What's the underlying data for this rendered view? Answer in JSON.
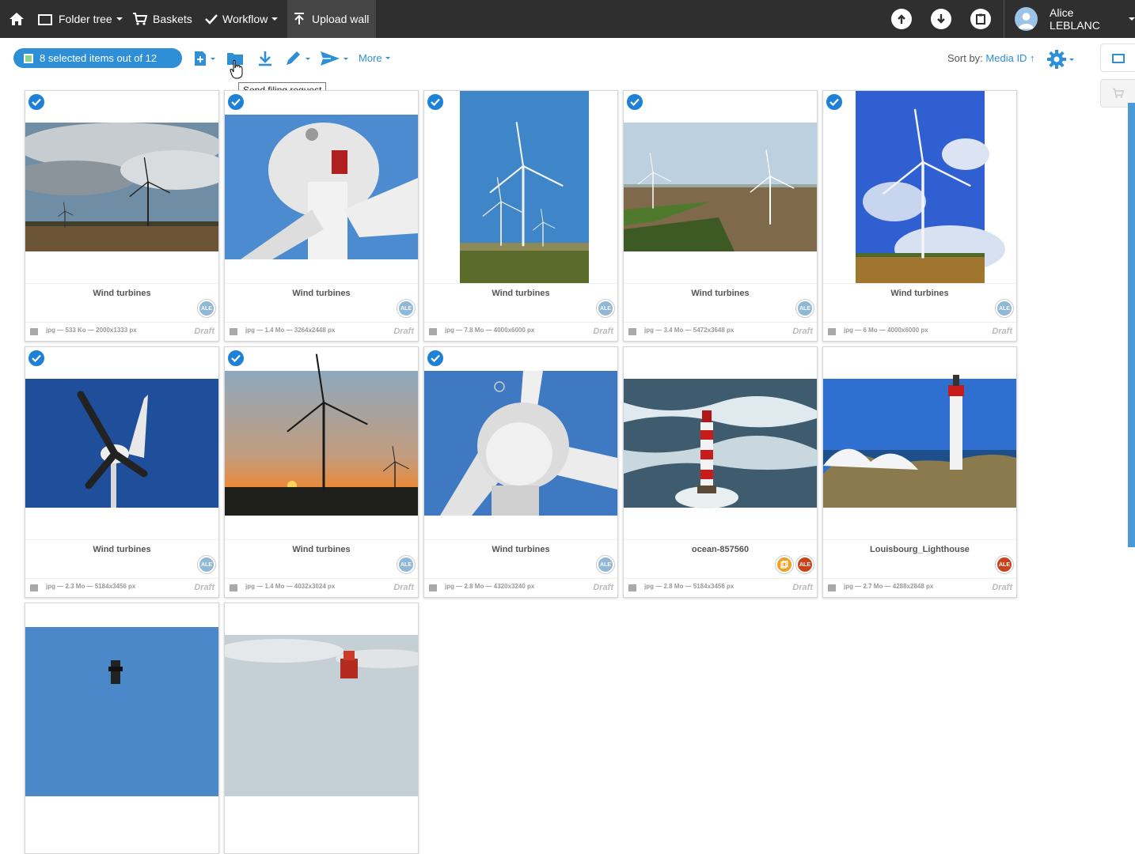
{
  "nav": {
    "folder_tree": "Folder tree",
    "baskets": "Baskets",
    "workflow": "Workflow",
    "upload_wall": "Upload wall",
    "user_name": "Alice LEBLANC"
  },
  "toolbar": {
    "selection_label": "8 selected items out of 12",
    "more_label": "More",
    "tooltip": "Send filing request",
    "sort_label": "Sort by:",
    "sort_value": "Media ID ↑"
  },
  "cards": [
    {
      "title": "Wind turbines",
      "info": "jpg — 533 Ko — 2000x1333 px",
      "status": "Draft",
      "avatar": "ALE",
      "avatar_color": "#8fb8d6",
      "selected": true,
      "scene": "clouds-field"
    },
    {
      "title": "Wind turbines",
      "info": "jpg — 1.4 Mo — 3264x2448 px",
      "status": "Draft",
      "avatar": "ALE",
      "avatar_color": "#8fb8d6",
      "selected": true,
      "scene": "nacelle-closeup"
    },
    {
      "title": "Wind turbines",
      "info": "jpg — 7.8 Mo — 4000x6000 px",
      "status": "Draft",
      "avatar": "ALE",
      "avatar_color": "#8fb8d6",
      "selected": true,
      "scene": "three-turbines"
    },
    {
      "title": "Wind turbines",
      "info": "jpg — 3.4 Mo — 5472x3648 px",
      "status": "Draft",
      "avatar": "ALE",
      "avatar_color": "#8fb8d6",
      "selected": true,
      "scene": "farmland"
    },
    {
      "title": "Wind turbines",
      "info": "jpg — 6 Mo — 4000x6000 px",
      "status": "Draft",
      "avatar": "ALE",
      "avatar_color": "#8fb8d6",
      "selected": true,
      "scene": "blue-sky-wheat"
    },
    {
      "title": "Wind turbines",
      "info": "jpg — 2.3 Mo — 5184x3456 px",
      "status": "Draft",
      "avatar": "ALE",
      "avatar_color": "#8fb8d6",
      "selected": true,
      "scene": "small-turbine"
    },
    {
      "title": "Wind turbines",
      "info": "jpg — 1.4 Mo — 4032x3024 px",
      "status": "Draft",
      "avatar": "ALE",
      "avatar_color": "#8fb8d6",
      "selected": true,
      "scene": "sunset"
    },
    {
      "title": "Wind turbines",
      "info": "jpg — 2.8 Mo — 4320x3240 px",
      "status": "Draft",
      "avatar": "ALE",
      "avatar_color": "#8fb8d6",
      "selected": true,
      "scene": "hub-closeup"
    },
    {
      "title": "ocean-857560",
      "info": "jpg — 2.8 Mo — 5184x3456 px",
      "status": "Draft",
      "avatar": "ALE",
      "avatar_color": "#c8431a",
      "selected": false,
      "has_copy_badge": true,
      "scene": "lighthouse-sea"
    },
    {
      "title": "Louisbourg_Lighthouse",
      "info": "jpg — 2.7 Mo — 4288x2848 px",
      "status": "Draft",
      "avatar": "ALE",
      "avatar_color": "#c8431a",
      "selected": false,
      "scene": "lighthouse-rocks"
    },
    {
      "title": "",
      "info": "",
      "status": "",
      "selected": false,
      "scene": "partial-lighthouse-1"
    },
    {
      "title": "",
      "info": "",
      "status": "",
      "selected": false,
      "scene": "partial-lighthouse-2"
    }
  ],
  "icons": {
    "home": "home-icon",
    "folder": "folder-icon",
    "basket": "cart-icon",
    "workflow": "check-icon",
    "upload": "upload-icon",
    "download": "download-icon",
    "clipboard": "clipboard-icon",
    "avatar": "user-avatar-icon",
    "add_file": "add-file-icon",
    "send_filing": "folder-icon",
    "pencil": "pencil-icon",
    "send": "send-icon",
    "gear": "gear-icon"
  },
  "colors": {
    "accent": "#2e8fd6",
    "topbar": "#2f2f2f",
    "selected_check": "#1e80d6"
  }
}
